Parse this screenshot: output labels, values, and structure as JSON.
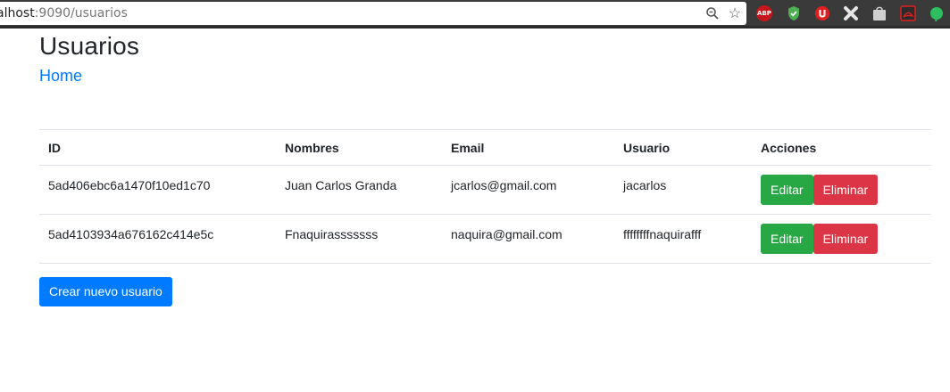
{
  "browser": {
    "url_host": "alhost",
    "url_rest": ":9090/usuarios"
  },
  "page": {
    "title": "Usuarios",
    "home_link": "Home"
  },
  "table": {
    "headers": [
      "ID",
      "Nombres",
      "Email",
      "Usuario",
      "Acciones"
    ],
    "rows": [
      {
        "id": "5ad406ebc6a1470f10ed1c70",
        "nombres": "Juan Carlos Granda",
        "email": "jcarlos@gmail.com",
        "usuario": "jacarlos",
        "edit_label": "Editar",
        "delete_label": "Eliminar"
      },
      {
        "id": "5ad4103934a676162c414e5c",
        "nombres": "Fnaquirasssssss",
        "email": "naquira@gmail.com",
        "usuario": "ffffffffnaquirafff",
        "edit_label": "Editar",
        "delete_label": "Eliminar"
      }
    ]
  },
  "actions": {
    "create_label": "Crear nuevo usuario"
  },
  "colors": {
    "primary": "#007bff",
    "success": "#28a745",
    "danger": "#dc3545"
  }
}
